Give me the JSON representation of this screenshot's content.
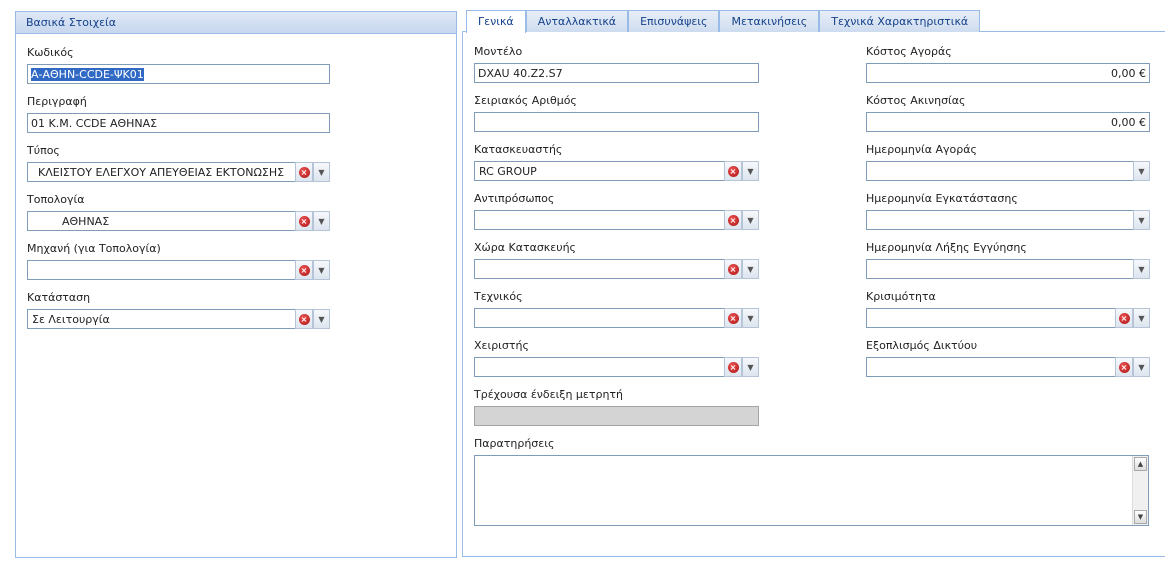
{
  "left": {
    "header": "Βασικά Στοιχεία",
    "code_label": "Κωδικός",
    "code_value": "Α-ΑΘΗΝ-CCDE-ΨΚ01",
    "description_label": "Περιγραφή",
    "description_value": "01 Κ.Μ. CCDE ΑΘΗΝΑΣ",
    "type_label": "Τύπος",
    "type_value": "ΚΛΕΙΣΤΟΥ ΕΛΕΓΧΟΥ ΑΠΕΥΘΕΙΑΣ ΕΚΤΟΝΩΣΗΣ",
    "topology_label": "Τοπολογία",
    "topology_value": "ΑΘΗΝΑΣ",
    "machine_label": "Μηχανή (για Τοπολογία)",
    "machine_value": "",
    "status_label": "Κατάσταση",
    "status_value": "Σε Λειτουργία"
  },
  "tabs": [
    {
      "label": "Γενικά",
      "active": true
    },
    {
      "label": "Ανταλλακτικά",
      "active": false
    },
    {
      "label": "Επισυνάψεις",
      "active": false
    },
    {
      "label": "Μετακινήσεις",
      "active": false
    },
    {
      "label": "Τεχνικά Χαρακτηριστικά",
      "active": false
    }
  ],
  "general": {
    "model_label": "Μοντέλο",
    "model_value": "DXAU 40.Z2.S7",
    "serial_label": "Σειριακός Αριθμός",
    "serial_value": "",
    "manufacturer_label": "Κατασκευαστής",
    "manufacturer_value": "RC GROUP",
    "representative_label": "Αντιπρόσωπος",
    "representative_value": "",
    "country_label": "Χώρα Κατασκευής",
    "country_value": "",
    "technician_label": "Τεχνικός",
    "technician_value": "",
    "operator_label": "Χειριστής",
    "operator_value": "",
    "meter_label": "Τρέχουσα ένδειξη μετρητή",
    "meter_value": "",
    "notes_label": "Παρατηρήσεις",
    "notes_value": "",
    "purchase_cost_label": "Κόστος Αγοράς",
    "purchase_cost_value": "0,00 €",
    "idle_cost_label": "Κόστος Ακινησίας",
    "idle_cost_value": "0,00 €",
    "purchase_date_label": "Ημερομηνία Αγοράς",
    "purchase_date_value": "",
    "install_date_label": "Ημερομηνία Εγκατάστασης",
    "install_date_value": "",
    "warranty_date_label": "Ημερομηνία Λήξης Εγγύησης",
    "warranty_date_value": "",
    "criticality_label": "Κρισιμότητα",
    "criticality_value": "",
    "network_label": "Εξοπλισμός Δικτύου",
    "network_value": ""
  }
}
